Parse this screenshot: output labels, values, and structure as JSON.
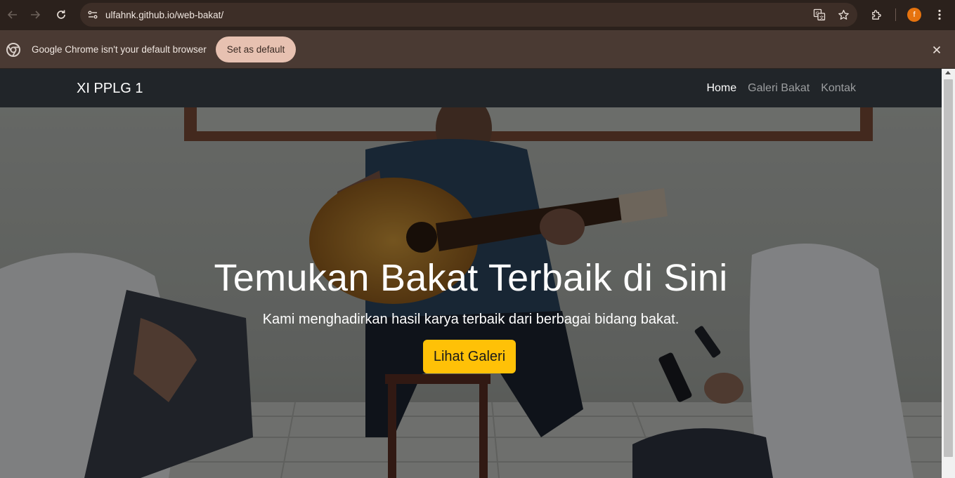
{
  "browser": {
    "url": "ulfahnk.github.io/web-bakat/",
    "profile_initial": "f"
  },
  "infobar": {
    "message": "Google Chrome isn't your default browser",
    "button_label": "Set as default"
  },
  "site": {
    "brand": "XI PPLG 1",
    "nav": [
      {
        "label": "Home",
        "active": true
      },
      {
        "label": "Galeri Bakat",
        "active": false
      },
      {
        "label": "Kontak",
        "active": false
      }
    ]
  },
  "hero": {
    "title": "Temukan Bakat Terbaik di Sini",
    "subtitle": "Kami menghadirkan hasil karya terbaik dari berbagai bidang bakat.",
    "cta_label": "Lihat Galeri",
    "cta_color": "#ffc107"
  }
}
